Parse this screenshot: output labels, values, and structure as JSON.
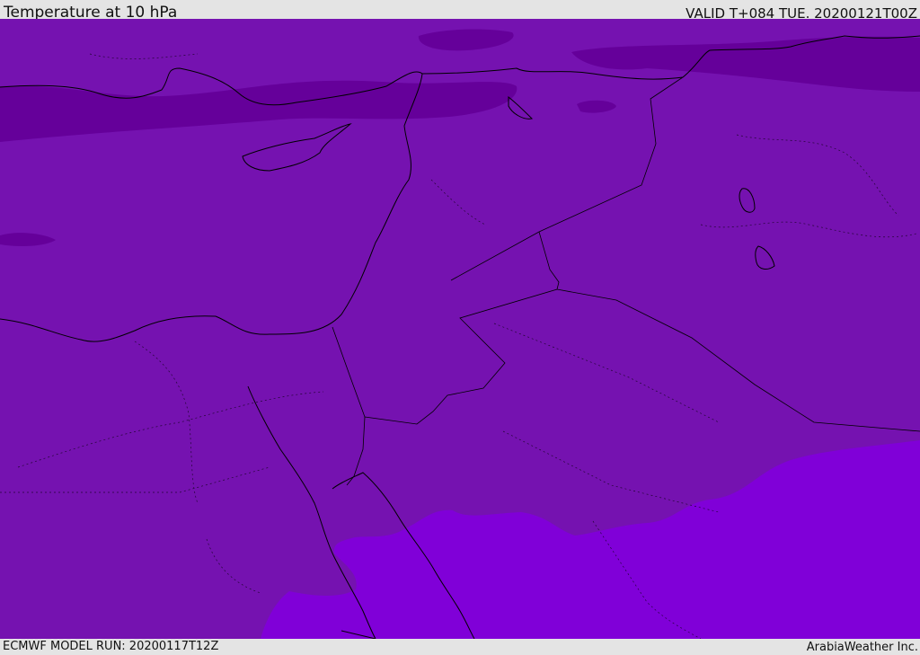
{
  "header": {
    "title": "Temperature at 10 hPa",
    "valid": "VALID T+084 TUE. 20200121T00Z"
  },
  "footer": {
    "model_run": "ECMWF MODEL RUN: 20200117T12Z",
    "credit": "ArabiaWeather Inc."
  },
  "colors": {
    "base_field": "#7512b0",
    "cold_band": "#65009a",
    "warm_region": "#8000d8",
    "coastline": "#000000"
  }
}
